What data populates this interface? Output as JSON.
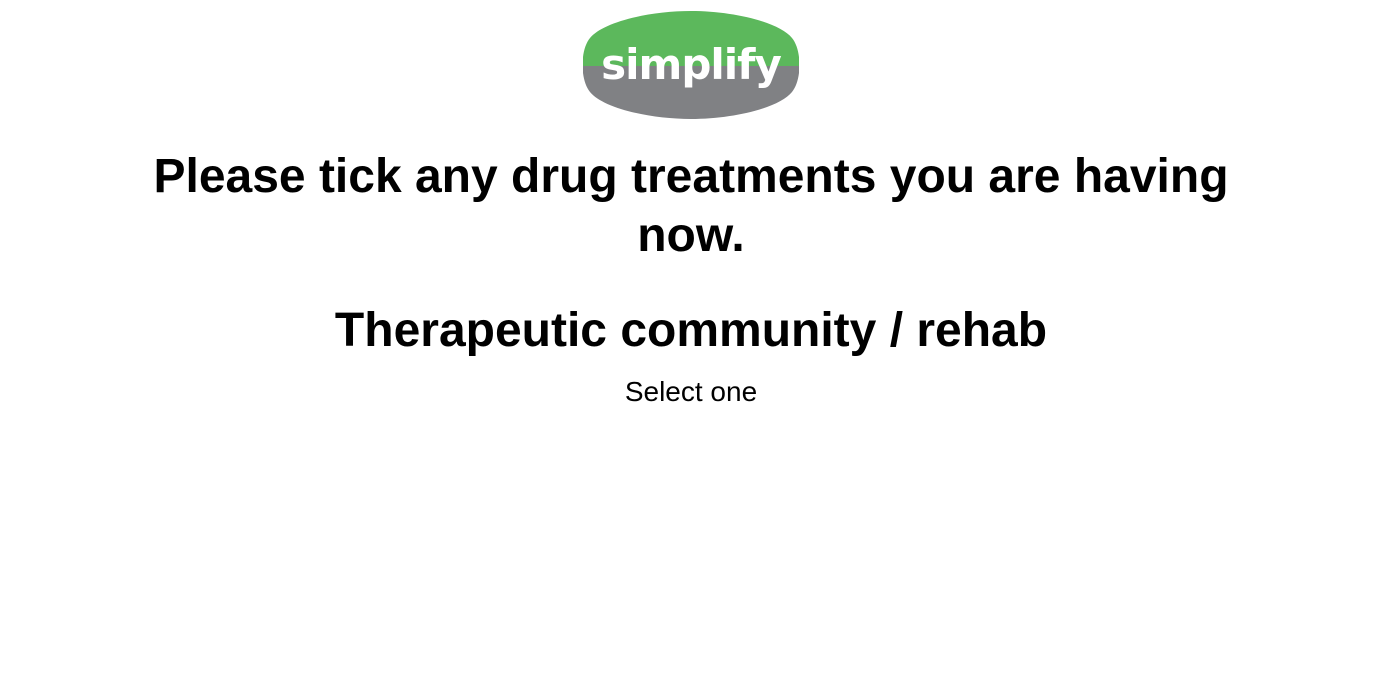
{
  "logo": {
    "text": "simplify",
    "colors": {
      "top": "#5cb85c",
      "bottom": "#808184",
      "text": "#ffffff"
    }
  },
  "question": {
    "text": "Please tick any drug treatments you are having now."
  },
  "section": {
    "title": "Therapeutic community / rehab",
    "instruction": "Select one"
  }
}
